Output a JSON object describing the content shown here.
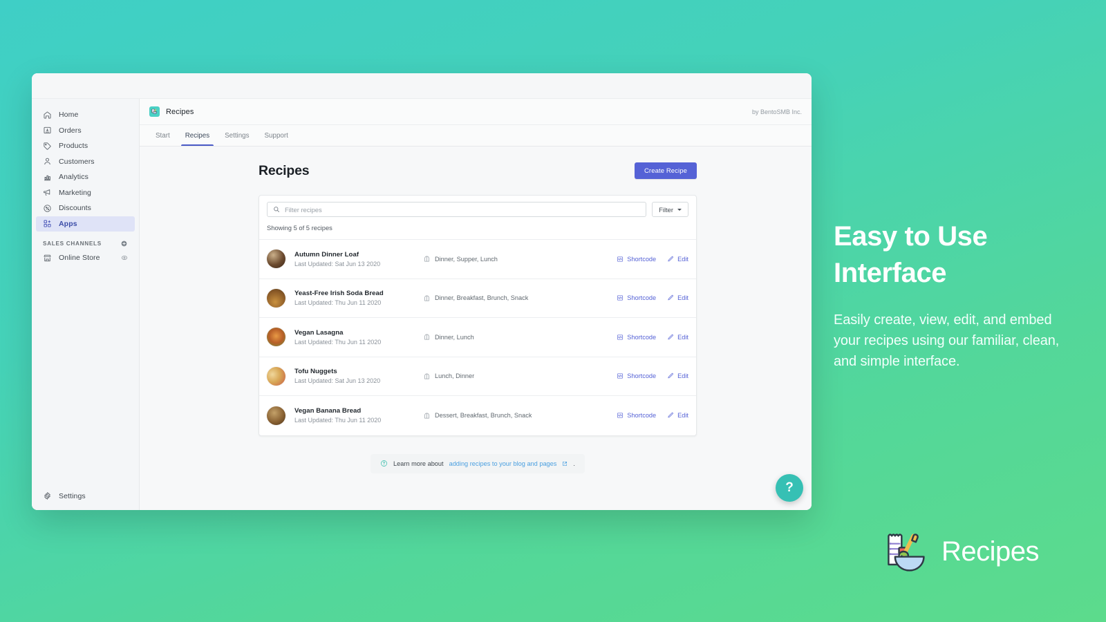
{
  "colors": {
    "bg_gradient_start": "#3fcfc6",
    "bg_gradient_end": "#5cdb8c",
    "accent_indigo": "#5562d6",
    "teal": "#36c0b4",
    "link_blue": "#4a9fe0"
  },
  "sidebar": {
    "items": [
      {
        "label": "Home",
        "icon": "home-icon"
      },
      {
        "label": "Orders",
        "icon": "orders-icon"
      },
      {
        "label": "Products",
        "icon": "tag-icon"
      },
      {
        "label": "Customers",
        "icon": "person-icon"
      },
      {
        "label": "Analytics",
        "icon": "bar-chart-icon"
      },
      {
        "label": "Marketing",
        "icon": "megaphone-icon"
      },
      {
        "label": "Discounts",
        "icon": "percent-circle-icon"
      },
      {
        "label": "Apps",
        "icon": "apps-grid-icon"
      }
    ],
    "section_title": "SALES CHANNELS",
    "add_channel_icon": "plus-circle-icon",
    "channels": [
      {
        "label": "Online Store",
        "icon": "storefront-icon",
        "trailing_icon": "eye-icon"
      }
    ],
    "settings": {
      "label": "Settings",
      "icon": "gear-icon"
    }
  },
  "app": {
    "icon": "recipes-app-icon",
    "title": "Recipes",
    "credit": "by BentoSMB Inc.",
    "tabs": [
      {
        "label": "Start",
        "active": false
      },
      {
        "label": "Recipes",
        "active": true
      },
      {
        "label": "Settings",
        "active": false
      },
      {
        "label": "Support",
        "active": false
      }
    ]
  },
  "page": {
    "title": "Recipes",
    "create_button": "Create Recipe",
    "search": {
      "placeholder": "Filter recipes",
      "value": "",
      "icon": "search-icon"
    },
    "filter_button": {
      "label": "Filter",
      "icon": "chevron-down-icon"
    },
    "count_text": "Showing 5 of 5 recipes",
    "row_actions": {
      "shortcode_label": "Shortcode",
      "shortcode_icon": "code-icon",
      "edit_label": "Edit",
      "edit_icon": "pencil-icon"
    },
    "tag_icon": "meal-tag-icon",
    "recipes": [
      {
        "name": "Autumn Dinner Loaf",
        "updated": "Last Updated: Sat Jun 13 2020",
        "tags": "Dinner, Supper, Lunch",
        "thumb_colors": [
          "#6b4a2e",
          "#c9a070",
          "#3b2718"
        ]
      },
      {
        "name": "Yeast-Free Irish Soda Bread",
        "updated": "Last Updated: Thu Jun 11 2020",
        "tags": "Dinner, Breakfast, Brunch, Snack",
        "thumb_colors": [
          "#b9813f",
          "#8d5c28",
          "#6d8aa8"
        ]
      },
      {
        "name": "Vegan Lasagna",
        "updated": "Last Updated: Thu Jun 11 2020",
        "tags": "Dinner, Lunch",
        "thumb_colors": [
          "#d8802f",
          "#8c4a22",
          "#6f8c3a"
        ]
      },
      {
        "name": "Tofu Nuggets",
        "updated": "Last Updated: Sat Jun 13 2020",
        "tags": "Lunch, Dinner",
        "thumb_colors": [
          "#e8c98a",
          "#c95b43",
          "#b8904a"
        ]
      },
      {
        "name": "Vegan Banana Bread",
        "updated": "Last Updated: Thu Jun 11 2020",
        "tags": "Dessert, Breakfast, Brunch, Snack",
        "thumb_colors": [
          "#8a6233",
          "#5c3d1d",
          "#c3a169"
        ]
      }
    ],
    "footer_note": {
      "icon": "question-circle-icon",
      "prefix": "Learn more about",
      "link": "adding recipes to your blog and pages",
      "link_icon": "external-link-icon",
      "suffix": "."
    },
    "help_fab": {
      "label": "?",
      "icon": "question-mark-icon"
    }
  },
  "promo": {
    "heading": "Easy to Use Interface",
    "body": "Easily create, view, edit, and embed your recipes using our familiar, clean, and simple interface."
  },
  "brand": {
    "name": "Recipes",
    "mark_icon": "recipes-logo-icon"
  }
}
